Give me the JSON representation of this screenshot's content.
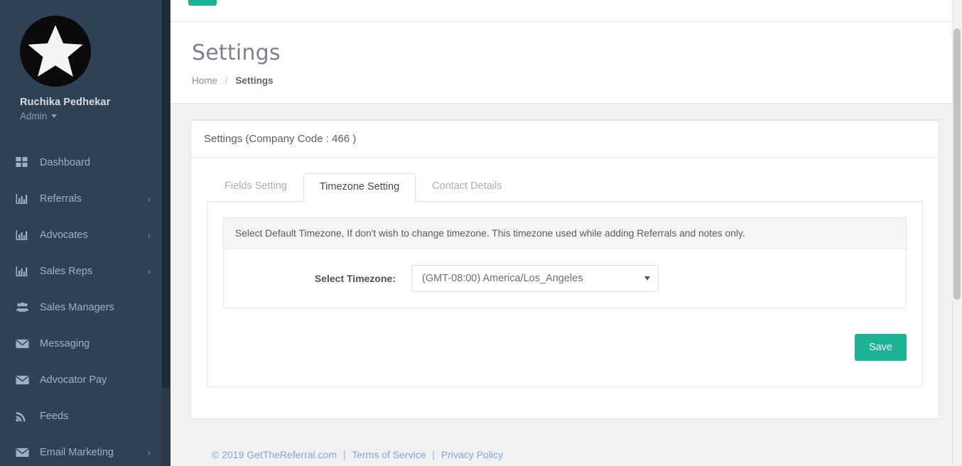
{
  "sidebar": {
    "profile": {
      "name": "Ruchika Pedhekar",
      "role": "Admin",
      "avatar_icon": "star-avatar-icon"
    },
    "items": [
      {
        "label": "Dashboard",
        "icon": "grid-icon",
        "chevron": "",
        "has_chevron": false
      },
      {
        "label": "Referrals",
        "icon": "bar-chart-icon",
        "chevron": "›",
        "has_chevron": true
      },
      {
        "label": "Advocates",
        "icon": "bar-chart-icon",
        "chevron": "›",
        "has_chevron": true
      },
      {
        "label": "Sales Reps",
        "icon": "bar-chart-icon",
        "chevron": "›",
        "has_chevron": true
      },
      {
        "label": "Sales Managers",
        "icon": "users-icon",
        "chevron": "",
        "has_chevron": false
      },
      {
        "label": "Messaging",
        "icon": "envelope-icon",
        "chevron": "",
        "has_chevron": false
      },
      {
        "label": "Advocator Pay",
        "icon": "envelope-icon",
        "chevron": "",
        "has_chevron": false
      },
      {
        "label": "Feeds",
        "icon": "rss-icon",
        "chevron": "",
        "has_chevron": false
      },
      {
        "label": "Email Marketing",
        "icon": "envelope-icon",
        "chevron": "›",
        "has_chevron": true
      }
    ]
  },
  "topbar": {
    "user_icon": "user-avatar-icon",
    "notification_icon": "bell-icon"
  },
  "pagehead": {
    "title": "Settings",
    "breadcrumb": {
      "home": "Home",
      "separator": "/",
      "current": "Settings"
    }
  },
  "card": {
    "header": "Settings (Company Code : 466 )",
    "tabs": [
      {
        "label": "Fields Setting",
        "active": false
      },
      {
        "label": "Timezone Setting",
        "active": true
      },
      {
        "label": "Contact Details",
        "active": false
      }
    ],
    "alert": "Select Default Timezone, If don't wish to change timezone. This timezone used while adding Referrals and notes only.",
    "form": {
      "timezone_label": "Select Timezone:",
      "timezone_value": "(GMT-08:00) America/Los_Angeles",
      "timezone_options": [
        "(GMT-08:00) America/Los_Angeles"
      ]
    },
    "save_label": "Save"
  },
  "footer": {
    "copyright": "© 2019 GetTheReferral.com",
    "sep1": "|",
    "terms": "Terms of Service",
    "sep2": "|",
    "privacy": "Privacy Policy"
  },
  "colors": {
    "sidebar_bg": "#2f4154",
    "accent_green": "#1cb394",
    "page_bg": "#f1f1f1",
    "link_blue": "#7fa8e0"
  }
}
